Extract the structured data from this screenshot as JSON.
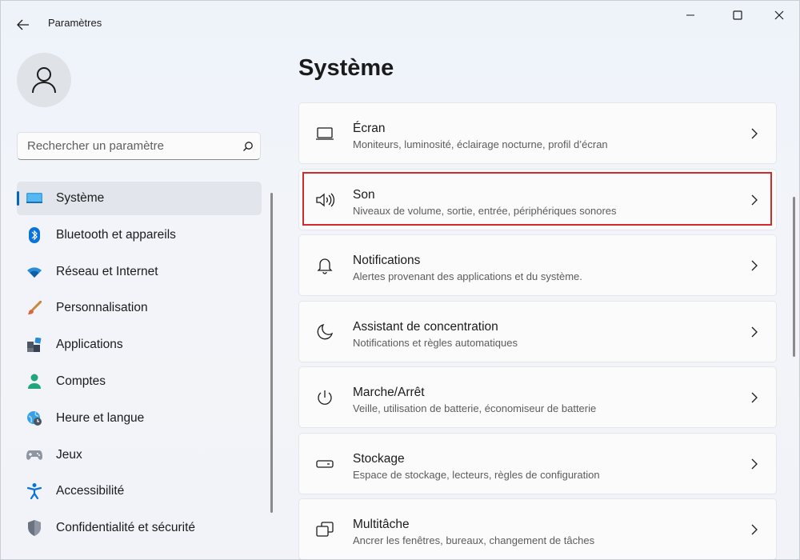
{
  "window": {
    "title": "Paramètres"
  },
  "search": {
    "placeholder": "Rechercher un paramètre"
  },
  "sidebar": {
    "items": [
      {
        "label": "Système",
        "icon": "monitor-icon",
        "active": true
      },
      {
        "label": "Bluetooth et appareils",
        "icon": "bluetooth-icon"
      },
      {
        "label": "Réseau et Internet",
        "icon": "wifi-icon"
      },
      {
        "label": "Personnalisation",
        "icon": "brush-icon"
      },
      {
        "label": "Applications",
        "icon": "apps-icon"
      },
      {
        "label": "Comptes",
        "icon": "person-icon"
      },
      {
        "label": "Heure et langue",
        "icon": "globe-clock-icon"
      },
      {
        "label": "Jeux",
        "icon": "gamepad-icon"
      },
      {
        "label": "Accessibilité",
        "icon": "accessibility-icon"
      },
      {
        "label": "Confidentialité et sécurité",
        "icon": "shield-icon"
      }
    ]
  },
  "main": {
    "title": "Système",
    "cards": [
      {
        "title": "Écran",
        "subtitle": "Moniteurs, luminosité, éclairage nocturne, profil d’écran",
        "icon": "display-icon"
      },
      {
        "title": "Son",
        "subtitle": "Niveaux de volume, sortie, entrée, périphériques sonores",
        "icon": "speaker-icon",
        "highlighted": true
      },
      {
        "title": "Notifications",
        "subtitle": "Alertes provenant des applications et du système.",
        "icon": "bell-icon"
      },
      {
        "title": "Assistant de concentration",
        "subtitle": "Notifications et règles automatiques",
        "icon": "moon-icon"
      },
      {
        "title": "Marche/Arrêt",
        "subtitle": "Veille, utilisation de batterie, économiseur de batterie",
        "icon": "power-icon"
      },
      {
        "title": "Stockage",
        "subtitle": "Espace de stockage, lecteurs, règles de configuration",
        "icon": "drive-icon"
      },
      {
        "title": "Multitâche",
        "subtitle": "Ancrer les fenêtres, bureaux, changement de tâches",
        "icon": "multitask-icon"
      }
    ]
  },
  "colors": {
    "accent": "#0067c0",
    "highlight": "#d12b2b"
  }
}
